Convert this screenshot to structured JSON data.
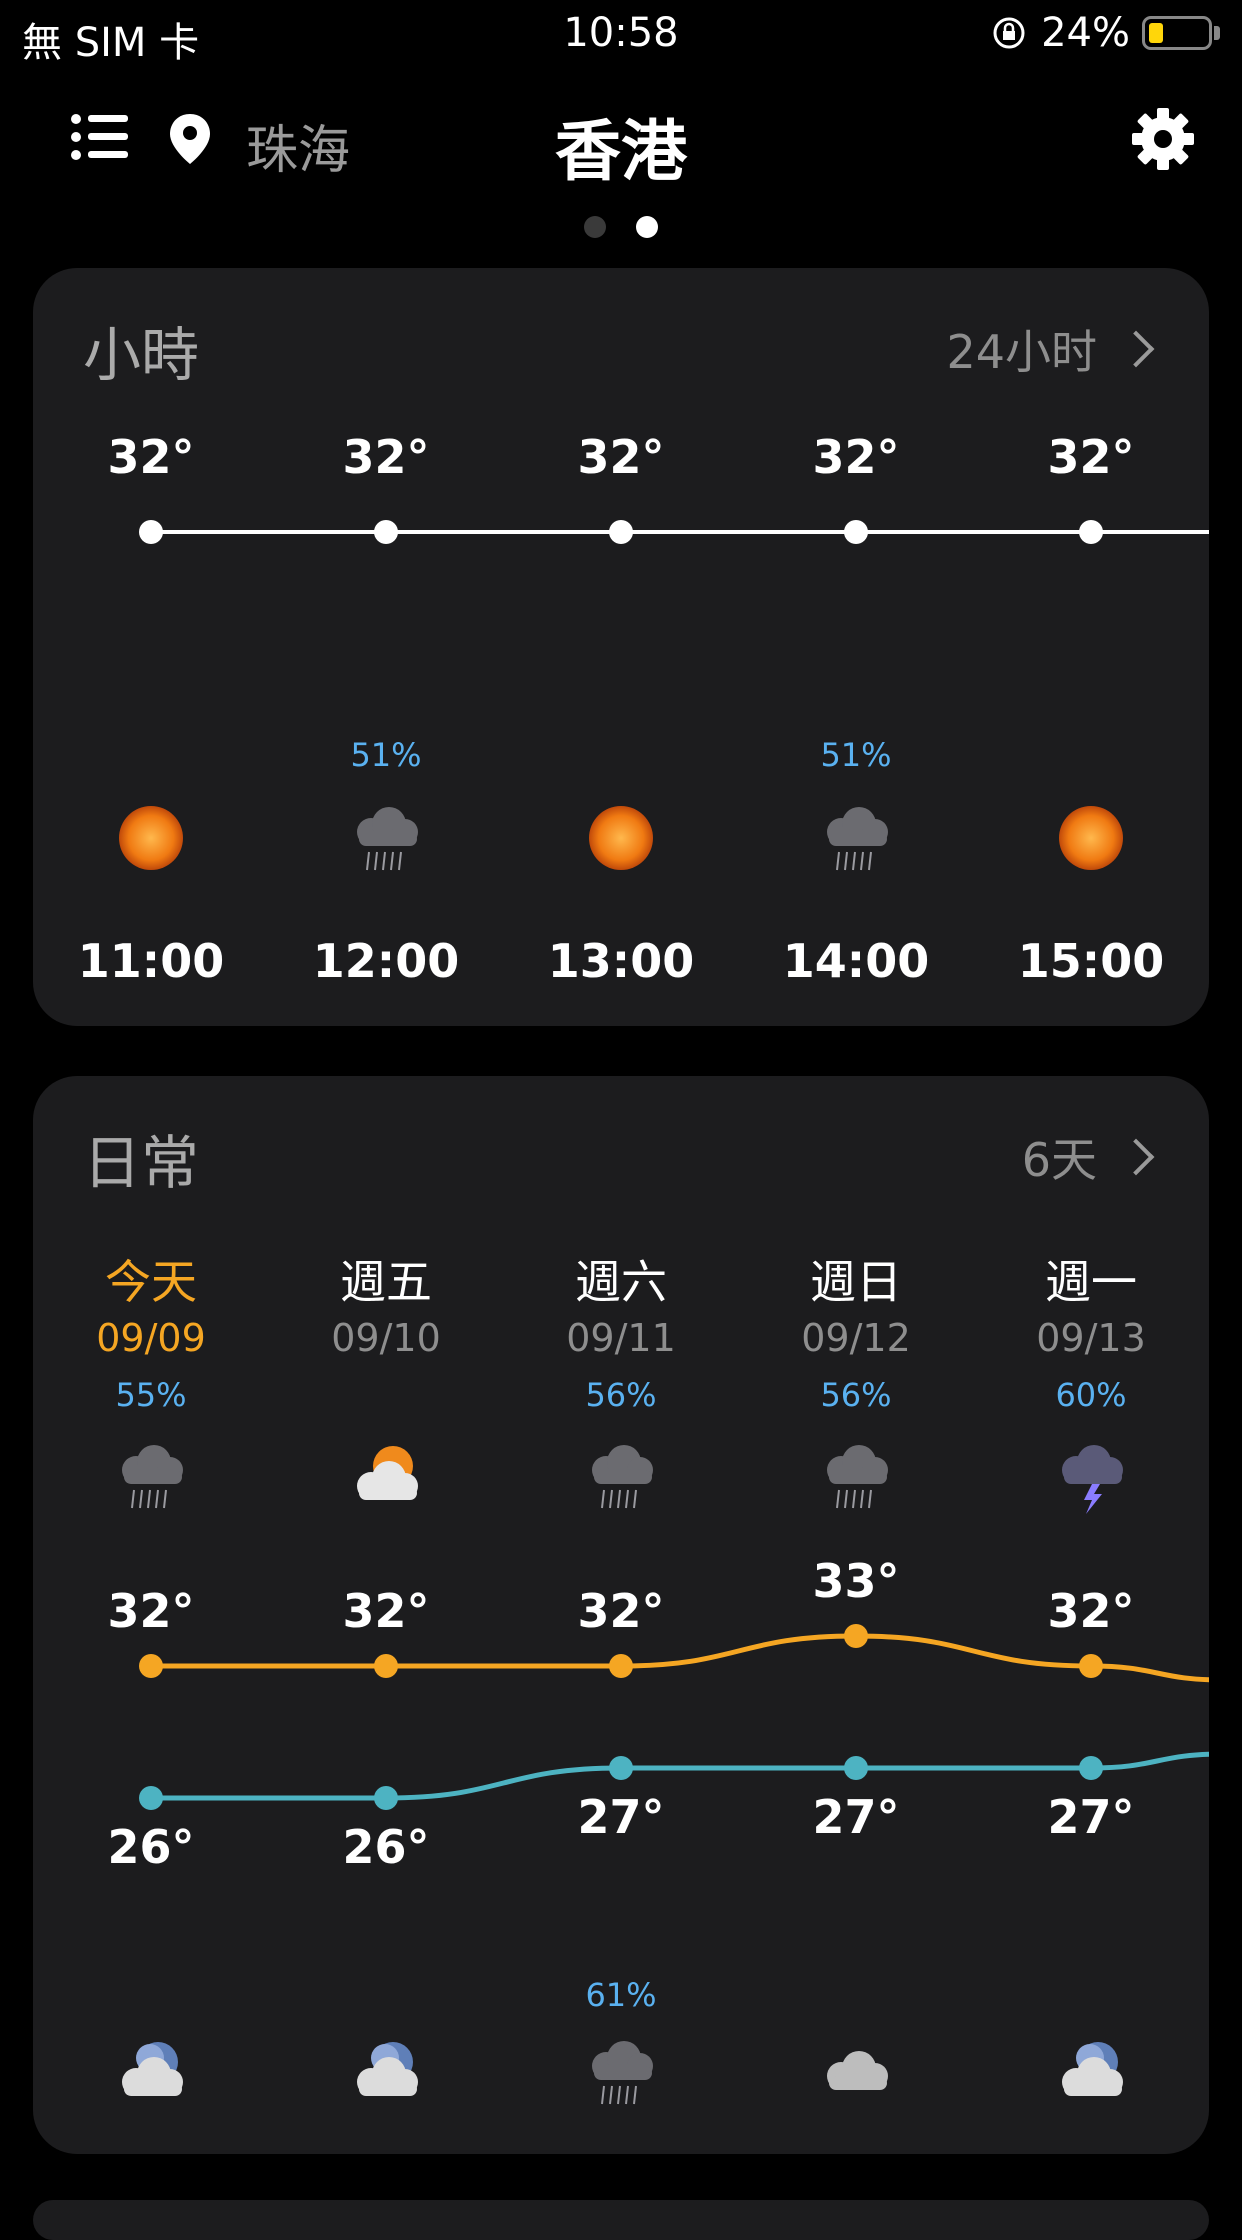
{
  "status_bar": {
    "carrier": "無 SIM 卡",
    "time": "10:58",
    "battery": "24%",
    "battery_level": 0.24
  },
  "header": {
    "location_label": "珠海",
    "city": "香港",
    "page_count": 2,
    "active_page": 1
  },
  "hourly": {
    "title": "小時",
    "more_label": "24小时",
    "hours": [
      {
        "time": "11:00",
        "temp": "32°",
        "precip": "",
        "icon": "sunny-icon"
      },
      {
        "time": "12:00",
        "temp": "32°",
        "precip": "51%",
        "icon": "rain-cloud-icon"
      },
      {
        "time": "13:00",
        "temp": "32°",
        "precip": "",
        "icon": "sunny-icon"
      },
      {
        "time": "14:00",
        "temp": "32°",
        "precip": "51%",
        "icon": "rain-cloud-icon"
      },
      {
        "time": "15:00",
        "temp": "32°",
        "precip": "",
        "icon": "sunny-icon"
      }
    ]
  },
  "daily": {
    "title": "日常",
    "more_label": "6天",
    "days": [
      {
        "name": "今天",
        "date": "09/09",
        "day_precip": "55%",
        "day_icon": "rain-cloud-icon",
        "high": "32°",
        "low": "26°",
        "night_precip": "",
        "night_icon": "cloudy-night-icon",
        "is_today": true
      },
      {
        "name": "週五",
        "date": "09/10",
        "day_precip": "",
        "day_icon": "partly-cloudy-icon",
        "high": "32°",
        "low": "26°",
        "night_precip": "",
        "night_icon": "cloudy-night-icon",
        "is_today": false
      },
      {
        "name": "週六",
        "date": "09/11",
        "day_precip": "56%",
        "day_icon": "rain-cloud-icon",
        "high": "32°",
        "low": "27°",
        "night_precip": "61%",
        "night_icon": "rain-cloud-icon",
        "is_today": false
      },
      {
        "name": "週日",
        "date": "09/12",
        "day_precip": "56%",
        "day_icon": "rain-cloud-icon",
        "high": "33°",
        "low": "27°",
        "night_precip": "",
        "night_icon": "cloud-icon",
        "is_today": false
      },
      {
        "name": "週一",
        "date": "09/13",
        "day_precip": "60%",
        "day_icon": "thunderstorm-icon",
        "high": "32°",
        "low": "27°",
        "night_precip": "",
        "night_icon": "cloudy-night-icon",
        "is_today": false
      }
    ]
  },
  "colors": {
    "accent": "#f5a623",
    "high_line": "#f5a623",
    "low_line": "#4db3c2",
    "precip": "#5ab1f0",
    "card": "#1c1c1e"
  }
}
